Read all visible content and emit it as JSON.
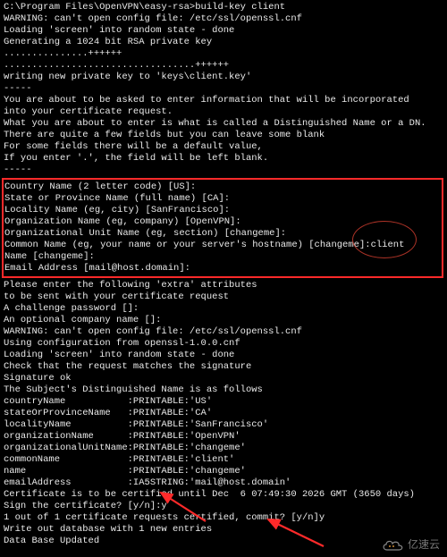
{
  "prompt_line": "C:\\Program Files\\OpenVPN\\easy-rsa>build-key client",
  "pre_box": [
    "WARNING: can't open config file: /etc/ssl/openssl.cnf",
    "Loading 'screen' into random state - done",
    "Generating a 1024 bit RSA private key",
    "...............++++++",
    "..................................++++++",
    "writing new private key to 'keys\\client.key'",
    "-----",
    "You are about to be asked to enter information that will be incorporated",
    "into your certificate request.",
    "What you are about to enter is what is called a Distinguished Name or a DN.",
    "There are quite a few fields but you can leave some blank",
    "For some fields there will be a default value,",
    "If you enter '.', the field will be left blank.",
    "-----"
  ],
  "box": [
    "Country Name (2 letter code) [US]:",
    "State or Province Name (full name) [CA]:",
    "Locality Name (eg, city) [SanFrancisco]:",
    "Organization Name (eg, company) [OpenVPN]:",
    "Organizational Unit Name (eg, section) [changeme]:",
    "Common Name (eg, your name or your server's hostname) [changeme]:client",
    "Name [changeme]:",
    "Email Address [mail@host.domain]:"
  ],
  "post_box": [
    "Please enter the following 'extra' attributes",
    "to be sent with your certificate request",
    "A challenge password []:",
    "An optional company name []:",
    "WARNING: can't open config file: /etc/ssl/openssl.cnf",
    "Using configuration from openssl-1.0.0.cnf",
    "Loading 'screen' into random state - done",
    "Check that the request matches the signature",
    "Signature ok",
    "The Subject's Distinguished Name is as follows",
    "countryName           :PRINTABLE:'US'",
    "stateOrProvinceName   :PRINTABLE:'CA'",
    "localityName          :PRINTABLE:'SanFrancisco'",
    "organizationName      :PRINTABLE:'OpenVPN'",
    "organizationalUnitName:PRINTABLE:'changeme'",
    "commonName            :PRINTABLE:'client'",
    "name                  :PRINTABLE:'changeme'",
    "emailAddress          :IA5STRING:'mail@host.domain'",
    "Certificate is to be certified until Dec  6 07:49:30 2026 GMT (3650 days)",
    "Sign the certificate? [y/n]:y",
    "",
    "",
    "1 out of 1 certificate requests certified, commit? [y/n]y",
    "Write out database with 1 new entries",
    "Data Base Updated"
  ],
  "watermark": "亿速云"
}
